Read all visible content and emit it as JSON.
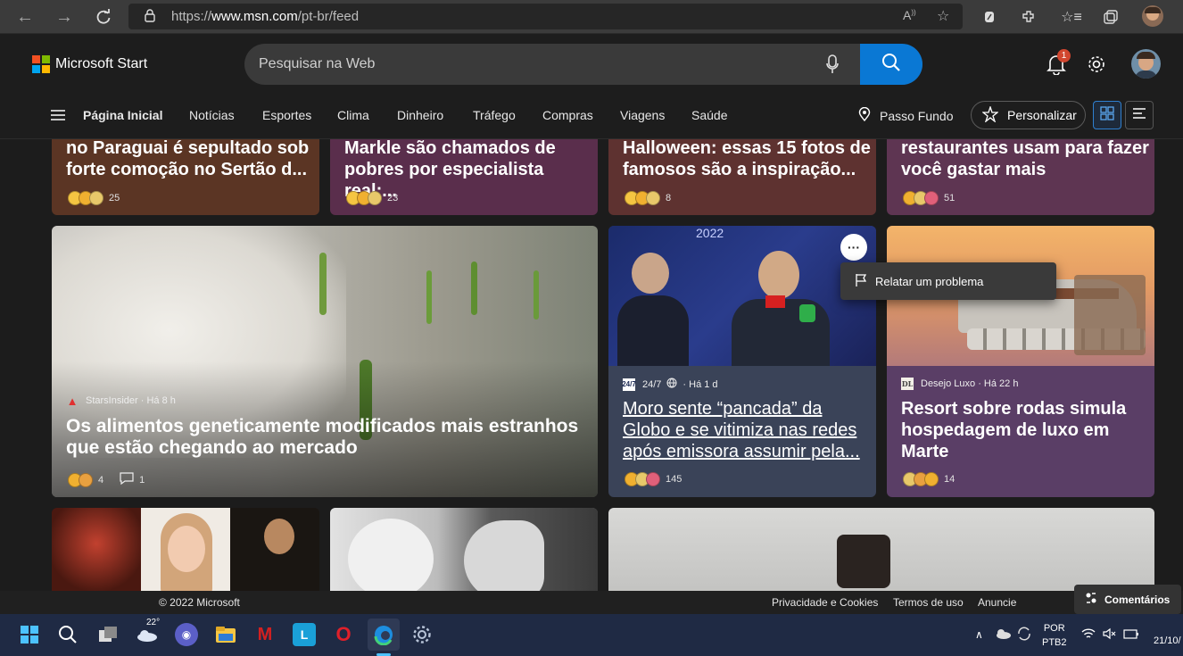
{
  "browser": {
    "url_prefix": "https://",
    "url_host": "www.msn.com",
    "url_path": "/pt-br/feed"
  },
  "header": {
    "brand": "Microsoft Start",
    "search_placeholder": "Pesquisar na Web",
    "notification_count": "1"
  },
  "nav": {
    "items": [
      "Página Inicial",
      "Notícias",
      "Esportes",
      "Clima",
      "Dinheiro",
      "Tráfego",
      "Compras",
      "Viagens",
      "Saúde"
    ],
    "location": "Passo Fundo",
    "personalize": "Personalizar"
  },
  "top_cards": [
    {
      "line1": "no Paraguai é sepultado sob",
      "line2": "forte comoção no Sertão d...",
      "count": "25"
    },
    {
      "line1": "Markle são chamados de",
      "line2": "pobres por especialista real:...",
      "count": "23"
    },
    {
      "line1": "Halloween: essas 15 fotos de",
      "line2": "famosos são a inspiração...",
      "count": "8"
    },
    {
      "line1": "restaurantes usam para fazer",
      "line2": "você gastar mais",
      "count": "51"
    }
  ],
  "feature_card": {
    "source": "StarsInsider · Há 8 h",
    "headline_line1": "Os alimentos geneticamente modificados mais estranhos",
    "headline_line2": "que estão chegando ao mercado",
    "reactions": "4",
    "comments": "1"
  },
  "moro_card": {
    "source_logo": "24/7",
    "source": "24/7",
    "time": "· Há 1 d",
    "image_text": "2022",
    "line1": "Moro sente “pancada” da",
    "line2": "Globo e se vitimiza nas redes",
    "line3": "após emissora assumir pela...",
    "reactions": "145"
  },
  "resort_card": {
    "source": "Desejo Luxo · Há 22 h",
    "line1": "Resort sobre rodas simula",
    "line2": "hospedagem de luxo em",
    "line3": "Marte",
    "reactions": "14"
  },
  "context_menu": {
    "item": "Relatar um problema",
    "more": "···"
  },
  "footer": {
    "copyright": "© 2022 Microsoft",
    "privacy": "Privacidade e Cookies",
    "terms": "Termos de uso",
    "advertise": "Anuncie",
    "feedback": "Comentários"
  },
  "taskbar": {
    "weather_temp": "22°",
    "lang_line1": "POR",
    "lang_line2": "PTB2",
    "date_partial": "21/10/"
  },
  "colors": {
    "accent": "#0a78d4",
    "card1": "#5b3524",
    "card2": "#5a2e4c",
    "card3": "#5e3230",
    "card4": "#5e3552",
    "moro_card": "#3a4358",
    "resort_card": "#5a3e66"
  }
}
